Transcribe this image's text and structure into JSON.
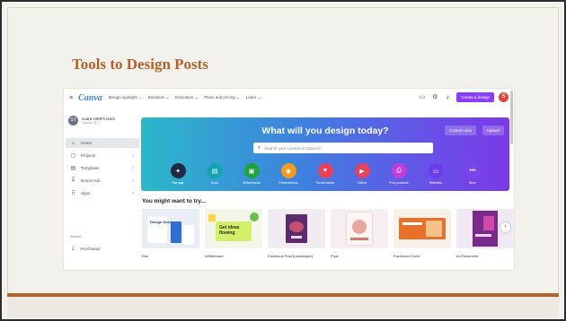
{
  "slide": {
    "title": "Tools to Design Posts",
    "colors": {
      "accent": "#b3622a",
      "background": "#f3f1ec"
    }
  },
  "canva": {
    "logo": "Canva",
    "nav": [
      "Design spotlight ⌄",
      "Business ⌄",
      "Education ⌄",
      "Plans and pricing ⌄",
      "Learn ⌄"
    ],
    "header_icons": [
      "monitor-icon",
      "settings-icon",
      "bell-icon"
    ],
    "create_button": "Create a design",
    "user_initial": "S",
    "brand_color": "#8b3dff",
    "sidebar": {
      "team_initials": "ST",
      "team_name": "suara HIMPs team",
      "team_sub": "Teams • 丝 1",
      "items": [
        {
          "label": "Home",
          "icon": "home-icon",
          "active": true
        },
        {
          "label": "Projects",
          "icon": "folder-icon"
        },
        {
          "label": "Templates",
          "icon": "template-icon"
        },
        {
          "label": "Brand Hub",
          "icon": "brand-icon"
        },
        {
          "label": "Apps",
          "icon": "apps-icon"
        }
      ],
      "section_label": "Starred",
      "purchased": "Purchased"
    },
    "hero": {
      "title": "What will you design today?",
      "custom_size": "Custom size",
      "upload": "Upload",
      "search_placeholder": "Search your content or Canva's",
      "categories": [
        {
          "label": "For you",
          "icon": "sparkle-icon",
          "color": "#1f2a44"
        },
        {
          "label": "Docs",
          "icon": "doc-icon",
          "color": "#13a3b5"
        },
        {
          "label": "Whiteboards",
          "icon": "whiteboard-icon",
          "color": "#1fa33a"
        },
        {
          "label": "Presentations",
          "icon": "presentation-icon",
          "color": "#f29b1d"
        },
        {
          "label": "Social media",
          "icon": "heart-icon",
          "color": "#e8405a"
        },
        {
          "label": "Videos",
          "icon": "video-icon",
          "color": "#e3425f"
        },
        {
          "label": "Print products",
          "icon": "print-icon",
          "color": "#c13fd6"
        },
        {
          "label": "Websites",
          "icon": "website-icon",
          "color": "#6a3de8"
        },
        {
          "label": "More",
          "icon": "more-icon",
          "color": "#7b44ea"
        }
      ]
    },
    "suggest_title": "You might want to try...",
    "cards": [
      {
        "label": "Doc",
        "color": "#e9edf6",
        "text": "Design Docs"
      },
      {
        "label": "Whiteboard",
        "color": "#f4f6ea",
        "text": "Get ideas flowing"
      },
      {
        "label": "Facebook Post (Landscape)",
        "color": "#f1ecf2",
        "text": ""
      },
      {
        "label": "Flyer",
        "color": "#f6eef0",
        "text": ""
      },
      {
        "label": "Facebook Cover",
        "color": "#f7f1ea",
        "text": ""
      },
      {
        "label": "A4 Document",
        "color": "#efe9f5",
        "text": ""
      }
    ]
  }
}
